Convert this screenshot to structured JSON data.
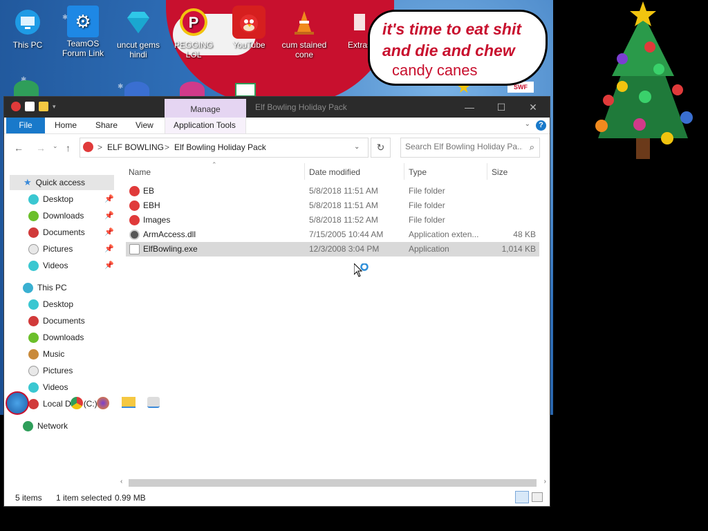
{
  "desktop": {
    "icons": [
      {
        "label": "This PC",
        "icon": "monitor-icon",
        "color": "#1e9be5"
      },
      {
        "label": "TeamOS Forum Link",
        "icon": "gear-icon",
        "color": "#1e88e5"
      },
      {
        "label": "uncut gems hindi",
        "icon": "diamond-icon",
        "color": "#2fc7e8"
      },
      {
        "label": "PEGGING LOL",
        "icon": "p-logo-icon",
        "color": "#d0103a"
      },
      {
        "label": "YouTube",
        "icon": "angry-bird-icon",
        "color": "#d61f1f"
      },
      {
        "label": "cum stained cone",
        "icon": "traffic-cone-icon",
        "color": "#f08a1e"
      },
      {
        "label": "Extras",
        "icon": "book-icon",
        "color": "#c8102e"
      }
    ],
    "bubble": {
      "line1": "it's time to eat shit",
      "line2": "and die and chew",
      "line3": "candy canes"
    },
    "swf_label": "SWF"
  },
  "explorer": {
    "title": "Elf Bowling Holiday Pack",
    "manage_tab": "Manage",
    "ribbon_tabs": {
      "file": "File",
      "home": "Home",
      "share": "Share",
      "view": "View",
      "app_tools": "Application Tools"
    },
    "help": "?",
    "address": {
      "crumb1": "ELF BOWLING",
      "crumb2": "Elf Bowling Holiday Pack",
      "sep": ">"
    },
    "search_placeholder": "Search Elf Bowling Holiday Pa...",
    "nav": {
      "quick_access": "Quick access",
      "qa_items": [
        "Desktop",
        "Downloads",
        "Documents",
        "Pictures",
        "Videos"
      ],
      "this_pc": "This PC",
      "pc_items": [
        "Desktop",
        "Documents",
        "Downloads",
        "Music",
        "Pictures",
        "Videos",
        "Local Disk (C:)"
      ],
      "network": "Network"
    },
    "columns": {
      "name": "Name",
      "date": "Date modified",
      "type": "Type",
      "size": "Size"
    },
    "files": [
      {
        "name": "EB",
        "date": "5/8/2018 11:51 AM",
        "type": "File folder",
        "size": ""
      },
      {
        "name": "EBH",
        "date": "5/8/2018 11:51 AM",
        "type": "File folder",
        "size": ""
      },
      {
        "name": "Images",
        "date": "5/8/2018 11:52 AM",
        "type": "File folder",
        "size": ""
      },
      {
        "name": "ArmAccess.dll",
        "date": "7/15/2005 10:44 AM",
        "type": "Application exten...",
        "size": "48 KB"
      },
      {
        "name": "ElfBowling.exe",
        "date": "12/3/2008 3:04 PM",
        "type": "Application",
        "size": "1,014 KB"
      }
    ],
    "status": {
      "items": "5 items",
      "selected": "1 item selected",
      "size": "0.99 MB"
    }
  },
  "colors": {
    "accent": "#1979ca",
    "manage": "#e5d5f2",
    "titlebar": "#2b2b2b",
    "selection": "#d9d9d9"
  }
}
